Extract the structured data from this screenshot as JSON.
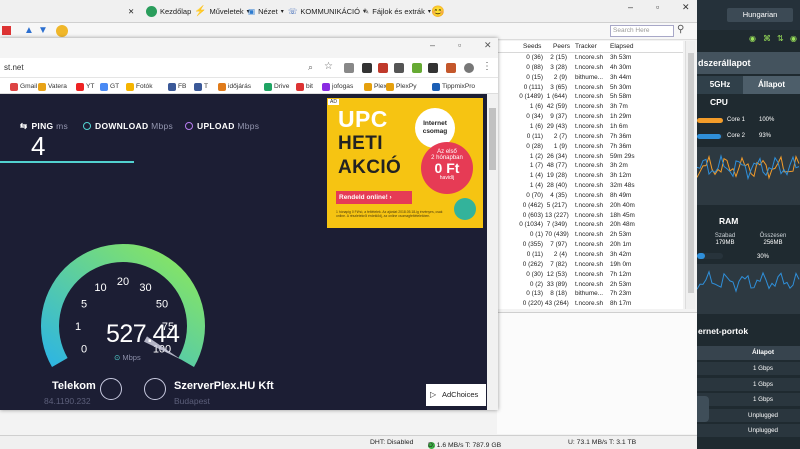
{
  "torrent_client": {
    "toolbar": {
      "home_label": "Kezdőlap",
      "actions_label": "Műveletek",
      "view_label": "Nézet",
      "communication_label": "KOMMUNIKÁCIÓ",
      "files_label": "Fájlok és extrák"
    },
    "search": {
      "placeholder": "Search Here"
    },
    "columns": {
      "seeds": "Seeds",
      "peers": "Peers",
      "tracker": "Tracker",
      "elapsed": "Elapsed"
    },
    "rows": [
      {
        "seeds": "0 (36)",
        "peers": "2 (15)",
        "tracker": "t.ncore.sh",
        "elapsed": "3h 53m"
      },
      {
        "seeds": "0 (88)",
        "peers": "3 (28)",
        "tracker": "t.ncore.sh",
        "elapsed": "4h 30m"
      },
      {
        "seeds": "0 (15)",
        "peers": "2 (9)",
        "tracker": "bithume...",
        "elapsed": "3h 44m"
      },
      {
        "seeds": "0 (111)",
        "peers": "3 (65)",
        "tracker": "t.ncore.sh",
        "elapsed": "5h 30m"
      },
      {
        "seeds": "0 (1489)",
        "peers": "1 (644)",
        "tracker": "t.ncore.sh",
        "elapsed": "5h 58m"
      },
      {
        "seeds": "1 (6)",
        "peers": "42 (59)",
        "tracker": "t.ncore.sh",
        "elapsed": "3h 7m"
      },
      {
        "seeds": "0 (34)",
        "peers": "9 (37)",
        "tracker": "t.ncore.sh",
        "elapsed": "1h 29m"
      },
      {
        "seeds": "1 (6)",
        "peers": "29 (43)",
        "tracker": "t.ncore.sh",
        "elapsed": "1h 6m"
      },
      {
        "seeds": "0 (11)",
        "peers": "2 (7)",
        "tracker": "t.ncore.sh",
        "elapsed": "7h 36m"
      },
      {
        "seeds": "0 (28)",
        "peers": "1 (9)",
        "tracker": "t.ncore.sh",
        "elapsed": "7h 36m"
      },
      {
        "seeds": "1 (2)",
        "peers": "26 (34)",
        "tracker": "t.ncore.sh",
        "elapsed": "59m 29s"
      },
      {
        "seeds": "1 (7)",
        "peers": "48 (77)",
        "tracker": "t.ncore.sh",
        "elapsed": "3h 2m"
      },
      {
        "seeds": "1 (4)",
        "peers": "19 (28)",
        "tracker": "t.ncore.sh",
        "elapsed": "3h 12m"
      },
      {
        "seeds": "1 (4)",
        "peers": "28 (40)",
        "tracker": "t.ncore.sh",
        "elapsed": "32m 48s"
      },
      {
        "seeds": "0 (70)",
        "peers": "4 (35)",
        "tracker": "t.ncore.sh",
        "elapsed": "8h 49m"
      },
      {
        "seeds": "0 (462)",
        "peers": "5 (217)",
        "tracker": "t.ncore.sh",
        "elapsed": "20h 40m"
      },
      {
        "seeds": "0 (603)",
        "peers": "13 (227)",
        "tracker": "t.ncore.sh",
        "elapsed": "18h 45m"
      },
      {
        "seeds": "0 (1034)",
        "peers": "7 (349)",
        "tracker": "t.ncore.sh",
        "elapsed": "20h 48m"
      },
      {
        "seeds": "0 (1)",
        "peers": "70 (439)",
        "tracker": "t.ncore.sh",
        "elapsed": "2h 53m"
      },
      {
        "seeds": "0 (355)",
        "peers": "7 (97)",
        "tracker": "t.ncore.sh",
        "elapsed": "20h 1m"
      },
      {
        "seeds": "0 (11)",
        "peers": "2 (4)",
        "tracker": "t.ncore.sh",
        "elapsed": "3h 42m"
      },
      {
        "seeds": "0 (262)",
        "peers": "7 (82)",
        "tracker": "t.ncore.sh",
        "elapsed": "19h 0m"
      },
      {
        "seeds": "0 (30)",
        "peers": "12 (53)",
        "tracker": "t.ncore.sh",
        "elapsed": "7h 12m"
      },
      {
        "seeds": "0 (2)",
        "peers": "33 (89)",
        "tracker": "t.ncore.sh",
        "elapsed": "2h 53m"
      },
      {
        "seeds": "0 (13)",
        "peers": "8 (18)",
        "tracker": "bithume...",
        "elapsed": "7h 23m"
      },
      {
        "seeds": "0 (220)",
        "peers": "43 (264)",
        "tracker": "t.ncore.sh",
        "elapsed": "8h 17m"
      }
    ],
    "status": {
      "dht": "DHT: Disabled",
      "download": "D: 1.6 MB/s T: 787.9 GB",
      "upload": "U: 73.1 MB/s T: 3.1 TB"
    }
  },
  "browser": {
    "url_fragment": "st.net",
    "bookmarks": [
      "Gmail",
      "Vatera",
      "YT",
      "GT",
      "Fotók",
      "FB",
      "T",
      "időjárás",
      "Drive",
      "bit",
      "jofogas",
      "Plex",
      "PlexPy",
      "TippmixPro"
    ]
  },
  "speedtest": {
    "ping_label": "PING",
    "ping_unit": "ms",
    "ping_value": "4",
    "download_label": "DOWNLOAD",
    "download_unit": "Mbps",
    "upload_label": "UPLOAD",
    "upload_unit": "Mbps",
    "current_speed": "527.44",
    "speed_unit": "Mbps",
    "gauge_ticks": [
      "0",
      "1",
      "5",
      "10",
      "20",
      "30",
      "50",
      "75",
      "100"
    ],
    "isp_name": "Telekom",
    "isp_ip": "84.1190.232",
    "server_name": "SzerverPlex.HU Kft",
    "server_location": "Budapest",
    "adchoices_label": "AdChoices",
    "colors": {
      "gauge_start": "#3ed7e6",
      "gauge_end": "#8de85a",
      "background": "#1c1e34"
    }
  },
  "ad": {
    "badge": "AD",
    "title_line1": "UPC",
    "title_line2": "HETI",
    "title_line3": "AKCIÓ",
    "badge_circle": "Internet csomag",
    "offer_line1": "Az első",
    "offer_line2": "2 hónapban",
    "offer_price": "0 Ft",
    "offer_unit": "havidíj",
    "cta": "Rendeld online!",
    "fine_print": "1 hónapig 0 Ft/hó, a feltételek. Az ajánlat 2018.05.18-ig érvényes, csak online. A részletekről érdeklődj, az online csomagfeltételekben."
  },
  "router": {
    "language": "Hungarian",
    "section_title": "dszerállapot",
    "tab_5ghz": "5GHz",
    "tab_status": "Állapot",
    "cpu_title": "CPU",
    "cores": [
      {
        "label": "Core 1",
        "value": "100%",
        "fraction": 1.0,
        "color": "#f39c2a"
      },
      {
        "label": "Core 2",
        "value": "93%",
        "fraction": 0.93,
        "color": "#2f8fd9"
      }
    ],
    "ram_title": "RAM",
    "ram_free_label": "Szabad",
    "ram_free_value": "179MB",
    "ram_total_label": "Összesen",
    "ram_total_value": "256MB",
    "ram_pct": "30%",
    "ram_fraction": 0.3,
    "ports_title": "ernet-portok",
    "ports_status_header": "Állapot",
    "ports": [
      "1 Gbps",
      "1 Gbps",
      "1 Gbps",
      "Unplugged",
      "Unplugged"
    ]
  }
}
